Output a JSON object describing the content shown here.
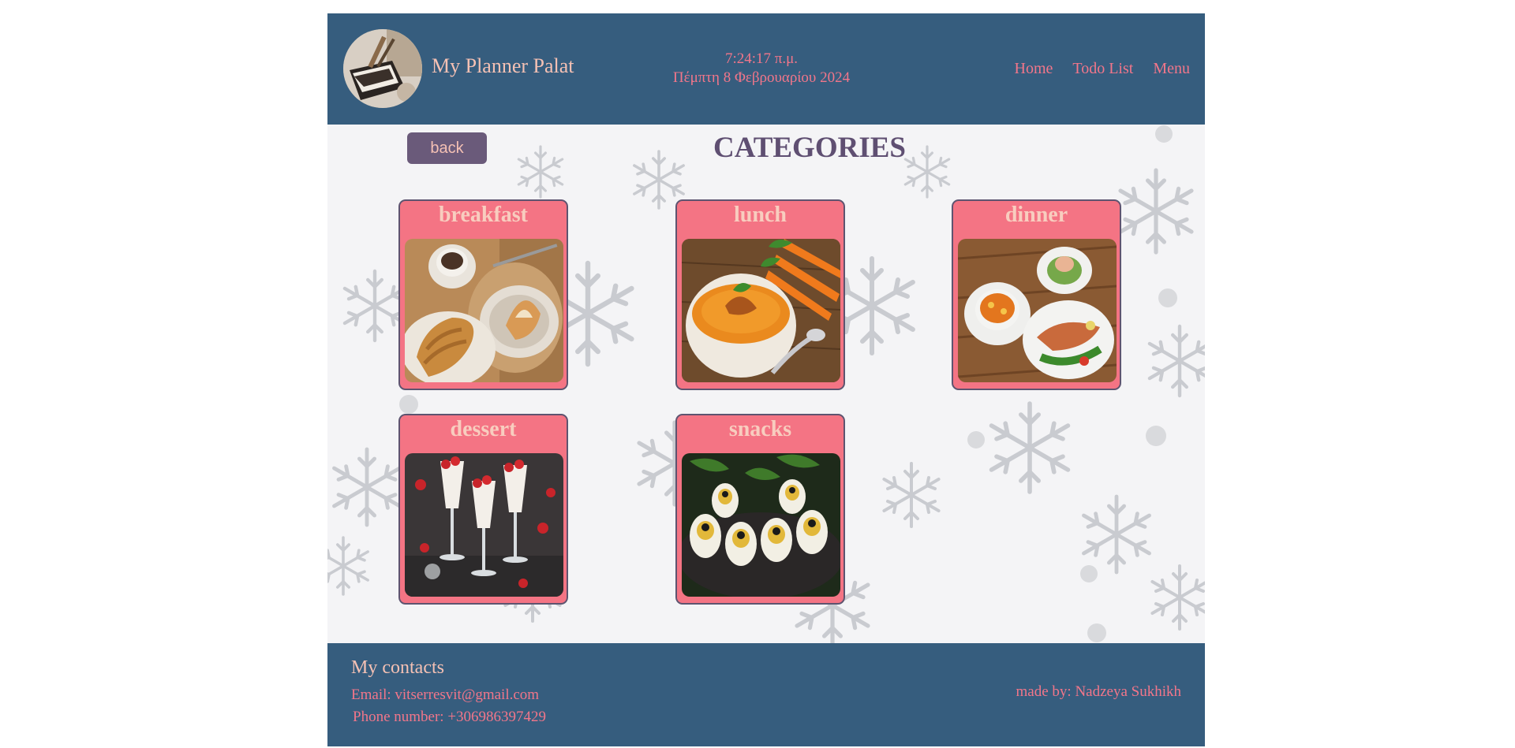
{
  "header": {
    "title": "My Planner Palat",
    "time": "7:24:17 π.μ.",
    "date": "Πέμπτη 8 Φεβρουαρίου 2024",
    "nav": [
      {
        "label": "Home"
      },
      {
        "label": "Todo List"
      },
      {
        "label": "Menu"
      }
    ]
  },
  "main": {
    "back_label": "back",
    "heading": "CATEGORIES",
    "categories": [
      {
        "label": "breakfast"
      },
      {
        "label": "lunch"
      },
      {
        "label": "dinner"
      },
      {
        "label": "dessert"
      },
      {
        "label": "snacks"
      }
    ]
  },
  "footer": {
    "contacts_title": "My contacts",
    "email": "Email: vitserresvit@gmail.com",
    "phone": "Phone number: +306986397429",
    "made_by": "made by: Nadzeya Sukhikh"
  },
  "colors": {
    "header_bg": "#365d7e",
    "accent_pink": "#f2768a",
    "card_bg": "#f47484",
    "title_peach": "#f5c1b4",
    "heading_purple": "#5f4f72",
    "button_bg": "#6a5a7a"
  }
}
